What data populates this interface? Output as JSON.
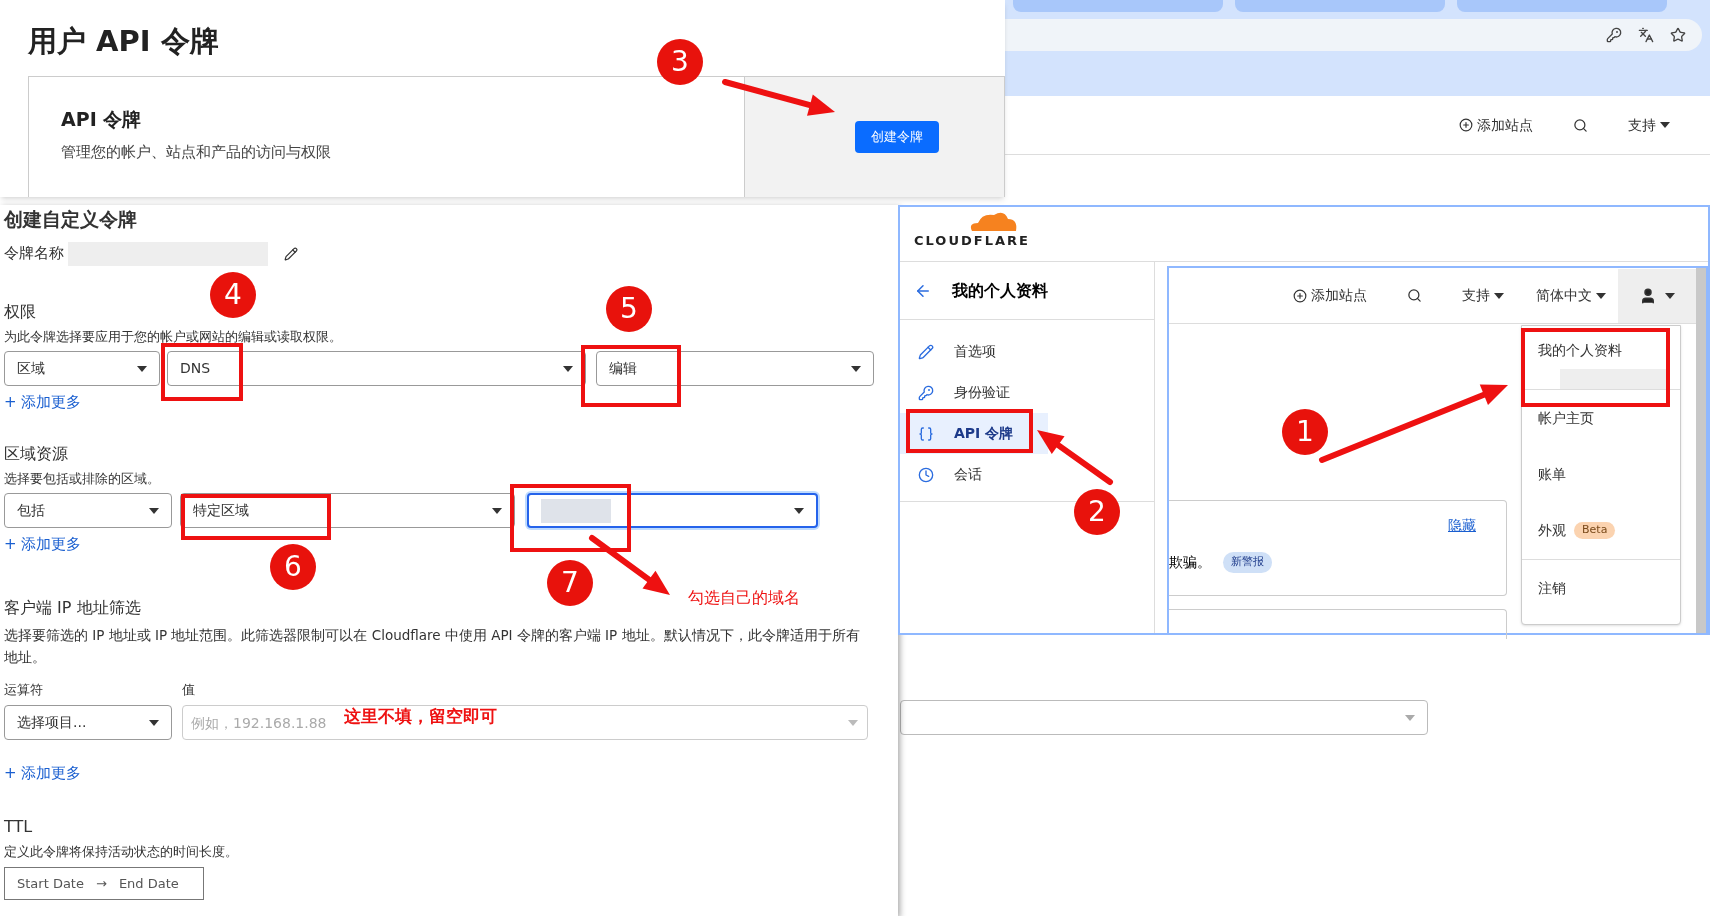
{
  "background_page": {
    "header_items": [
      {
        "label": "添加站点"
      },
      {
        "label": "支持"
      }
    ]
  },
  "token_list_panel": {
    "title": "用户 API 令牌",
    "card_title": "API 令牌",
    "card_description": "管理您的帐户、站点和产品的访问与权限",
    "create_button": "创建令牌"
  },
  "custom_token_form": {
    "title": "创建自定义令牌",
    "name_label": "令牌名称",
    "permissions": {
      "title": "权限",
      "description": "为此令牌选择要应用于您的帐户或网站的编辑或读取权限。",
      "selects": [
        "区域",
        "DNS",
        "编辑"
      ],
      "add_more": "+ 添加更多"
    },
    "zone_resources": {
      "title": "区域资源",
      "description": "选择要包括或排除的区域。",
      "selects": [
        "包括",
        "特定区域"
      ],
      "add_more": "+ 添加更多"
    },
    "ip_filter": {
      "title": "客户端 IP 地址筛选",
      "description": "选择要筛选的 IP 地址或 IP 地址范围。此筛选器限制可以在 Cloudflare 中使用 API 令牌的客户端 IP 地址。默认情况下，此令牌适用于所有地址。",
      "operator_label": "运算符",
      "value_label": "值",
      "operator_select": "选择项目...",
      "value_placeholder": "例如，192.168.1.88",
      "add_more": "+ 添加更多"
    },
    "ttl": {
      "title": "TTL",
      "description": "定义此令牌将保持活动状态的时间长度。",
      "start": "Start Date",
      "arrow": "→",
      "end": "End Date"
    }
  },
  "profile_panel": {
    "logo": "CLOUDFLARE",
    "back_title": "我的个人资料",
    "sidebar_items": [
      {
        "label": "首选项",
        "selected": false
      },
      {
        "label": "身份验证",
        "selected": false
      },
      {
        "label": "API 令牌",
        "selected": true
      },
      {
        "label": "会话",
        "selected": false
      }
    ],
    "top_nav": {
      "add_site": "添加站点",
      "support": "支持",
      "language": "简体中文"
    },
    "alert": {
      "link": "隐藏",
      "text": "欺骗。",
      "badge": "新警报"
    },
    "user_menu": [
      {
        "label": "我的个人资料"
      },
      {
        "label": "帐户主页"
      },
      {
        "label": "账单"
      },
      {
        "label": "外观",
        "badge": "Beta"
      },
      {
        "label": "注销"
      }
    ]
  },
  "annotations": {
    "steps": [
      "1",
      "2",
      "3",
      "4",
      "5",
      "6",
      "7"
    ],
    "notes": [
      "勾选自己的域名",
      "这里不填，留空即可"
    ]
  }
}
